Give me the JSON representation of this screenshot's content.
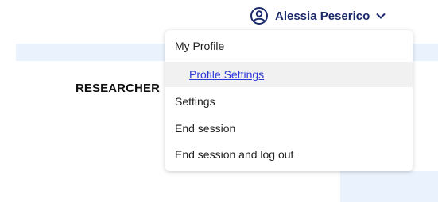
{
  "header": {
    "user_name": "Alessia Peserico",
    "user_icon": "account-circle-icon",
    "caret_icon": "chevron-down-icon"
  },
  "main": {
    "section_heading": "RESEARCHER"
  },
  "user_dropdown": {
    "items": [
      {
        "label": "My Profile"
      },
      {
        "label": "Profile Settings",
        "highlighted": true,
        "link": true
      },
      {
        "label": "Settings"
      },
      {
        "label": "End session"
      },
      {
        "label": "End session and log out"
      }
    ]
  },
  "colors": {
    "accent": "#1c2a6b",
    "link": "#2b3bd6",
    "panel_bg": "#eaf2fd",
    "highlight_bg": "#f1f1f1"
  }
}
